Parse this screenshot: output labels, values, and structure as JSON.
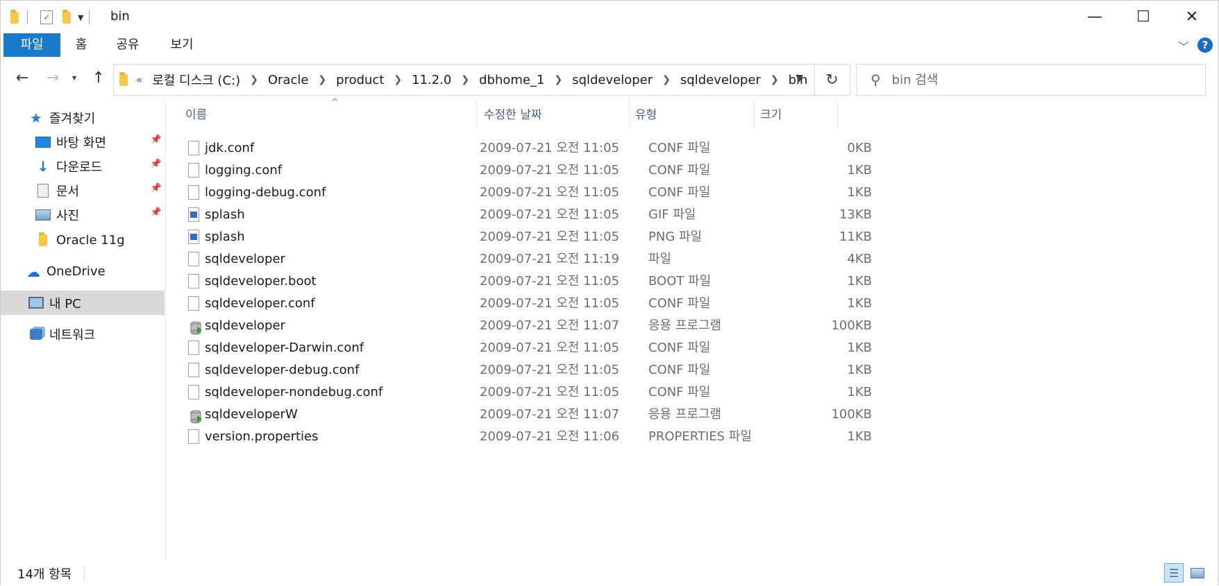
{
  "window": {
    "title": "bin",
    "minimize_glyph": "—",
    "maximize_glyph": "☐",
    "close_glyph": "✕"
  },
  "ribbon": {
    "tabs": [
      {
        "label": "파일",
        "active": true
      },
      {
        "label": "홈",
        "active": false
      },
      {
        "label": "공유",
        "active": false
      },
      {
        "label": "보기",
        "active": false
      }
    ],
    "help_label": "?"
  },
  "navigation": {
    "back_icon": "arrow-left-icon",
    "forward_icon": "arrow-right-icon",
    "recent_icon": "chevron-down-icon",
    "up_icon": "arrow-up-icon"
  },
  "address": {
    "overflow": "«",
    "crumbs": [
      "로컬 디스크 (C:)",
      "Oracle",
      "product",
      "11.2.0",
      "dbhome_1",
      "sqldeveloper",
      "sqldeveloper",
      "bin"
    ]
  },
  "search": {
    "placeholder": "bin 검색"
  },
  "sidebar": {
    "items": [
      {
        "label": "즐겨찾기",
        "icon": "star-icon",
        "pinned": false
      },
      {
        "label": "바탕 화면",
        "icon": "desktop-icon",
        "pinned": true
      },
      {
        "label": "다운로드",
        "icon": "download-icon",
        "pinned": true
      },
      {
        "label": "문서",
        "icon": "document-icon",
        "pinned": true
      },
      {
        "label": "사진",
        "icon": "pictures-icon",
        "pinned": true
      },
      {
        "label": "Oracle 11g",
        "icon": "folder-icon",
        "pinned": false
      },
      {
        "label": "OneDrive",
        "icon": "cloud-icon",
        "pinned": false
      },
      {
        "label": "내 PC",
        "icon": "computer-icon",
        "pinned": false,
        "selected": true
      },
      {
        "label": "네트워크",
        "icon": "network-icon",
        "pinned": false
      }
    ]
  },
  "columns": {
    "name": "이름",
    "date": "수정한 날짜",
    "type": "유형",
    "size": "크기"
  },
  "files": [
    {
      "name": "jdk.conf",
      "date": "2009-07-21 오전 11:05",
      "type": "CONF 파일",
      "size": "0KB",
      "icon": "file-icon"
    },
    {
      "name": "logging.conf",
      "date": "2009-07-21 오전 11:05",
      "type": "CONF 파일",
      "size": "1KB",
      "icon": "file-icon"
    },
    {
      "name": "logging-debug.conf",
      "date": "2009-07-21 오전 11:05",
      "type": "CONF 파일",
      "size": "1KB",
      "icon": "file-icon"
    },
    {
      "name": "splash",
      "date": "2009-07-21 오전 11:05",
      "type": "GIF 파일",
      "size": "13KB",
      "icon": "image-file-icon"
    },
    {
      "name": "splash",
      "date": "2009-07-21 오전 11:05",
      "type": "PNG 파일",
      "size": "11KB",
      "icon": "image-file-icon"
    },
    {
      "name": "sqldeveloper",
      "date": "2009-07-21 오전 11:19",
      "type": "파일",
      "size": "4KB",
      "icon": "file-icon"
    },
    {
      "name": "sqldeveloper.boot",
      "date": "2009-07-21 오전 11:05",
      "type": "BOOT 파일",
      "size": "1KB",
      "icon": "file-icon"
    },
    {
      "name": "sqldeveloper.conf",
      "date": "2009-07-21 오전 11:05",
      "type": "CONF 파일",
      "size": "1KB",
      "icon": "file-icon"
    },
    {
      "name": "sqldeveloper",
      "date": "2009-07-21 오전 11:07",
      "type": "응용 프로그램",
      "size": "100KB",
      "icon": "application-icon"
    },
    {
      "name": "sqldeveloper-Darwin.conf",
      "date": "2009-07-21 오전 11:05",
      "type": "CONF 파일",
      "size": "1KB",
      "icon": "file-icon"
    },
    {
      "name": "sqldeveloper-debug.conf",
      "date": "2009-07-21 오전 11:05",
      "type": "CONF 파일",
      "size": "1KB",
      "icon": "file-icon"
    },
    {
      "name": "sqldeveloper-nondebug.conf",
      "date": "2009-07-21 오전 11:05",
      "type": "CONF 파일",
      "size": "1KB",
      "icon": "file-icon"
    },
    {
      "name": "sqldeveloperW",
      "date": "2009-07-21 오전 11:07",
      "type": "응용 프로그램",
      "size": "100KB",
      "icon": "application-icon"
    },
    {
      "name": "version.properties",
      "date": "2009-07-21 오전 11:06",
      "type": "PROPERTIES 파일",
      "size": "1KB",
      "icon": "file-icon"
    }
  ],
  "status": {
    "item_count": "14개 항목"
  },
  "colors": {
    "accent": "#1979ca",
    "selection": "#d9d9d9",
    "header_text": "#4c607a",
    "muted_text": "#6d6d6d"
  }
}
